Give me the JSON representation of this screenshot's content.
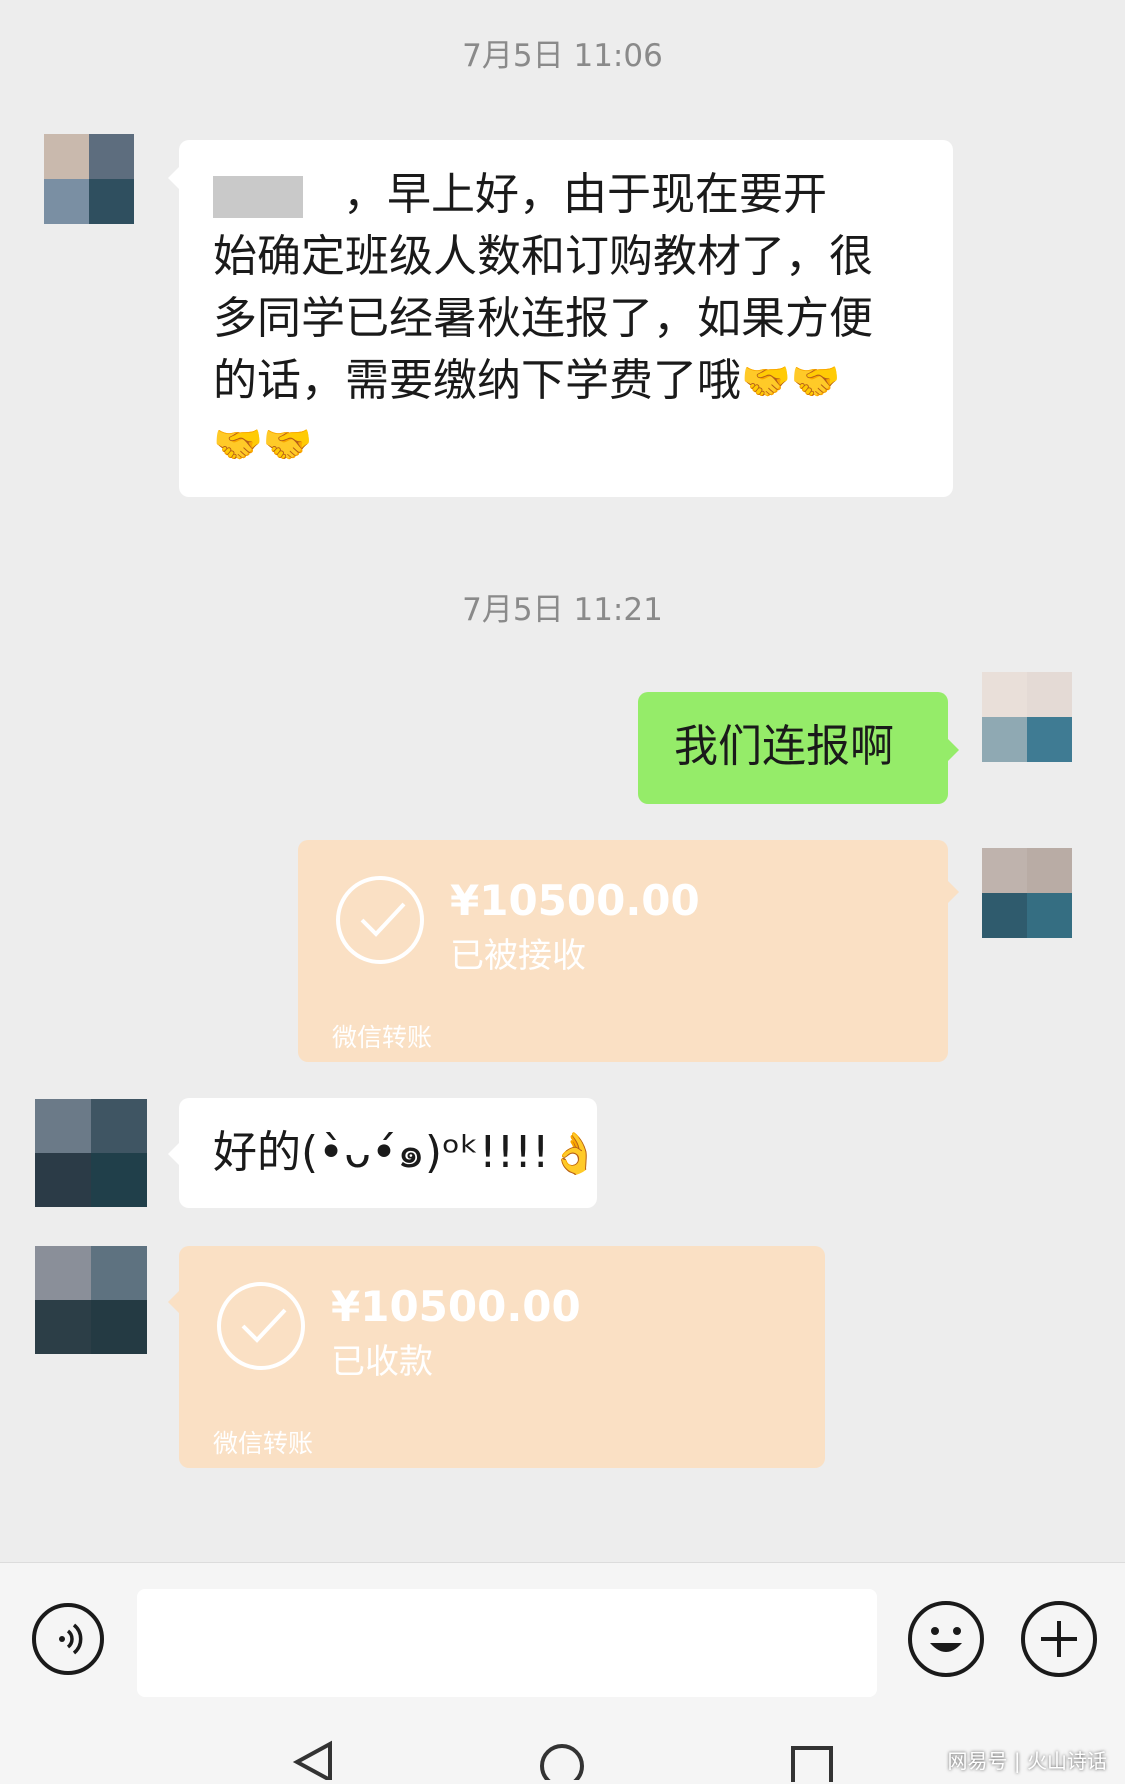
{
  "timestamps": [
    "7月5日 11:06",
    "7月5日 11:21"
  ],
  "messages": {
    "m1": {
      "line1": "，早上好，由于现在要开",
      "line2": "始确定班级人数和订购教材了，很",
      "line3": "多同学已经暑秋连报了，如果方便",
      "line4": "的话，需要缴纳下学费了哦",
      "emoji": "🤝",
      "emoji_count": 4
    },
    "m2": {
      "text": "我们连报啊"
    },
    "m3": {
      "amount": "¥10500.00",
      "status": "已被接收",
      "brand": "微信转账"
    },
    "m4": {
      "text": "好的(•̀ᴗ•́๑)ᵒᵏ!!!!",
      "emoji": "👌"
    },
    "m5": {
      "amount": "¥10500.00",
      "status": "已收款",
      "brand": "微信转账"
    }
  },
  "input_bar": {
    "voice_icon": "voice-icon",
    "emoji_icon": "smiley-icon",
    "plus_icon": "plus-icon"
  },
  "watermark": "网易号 | 火山诗话",
  "colors": {
    "background": "#ededed",
    "green_bubble": "#95ec69",
    "transfer_bubble": "#fae0c4",
    "timestamp_text": "#8a8a8a"
  }
}
